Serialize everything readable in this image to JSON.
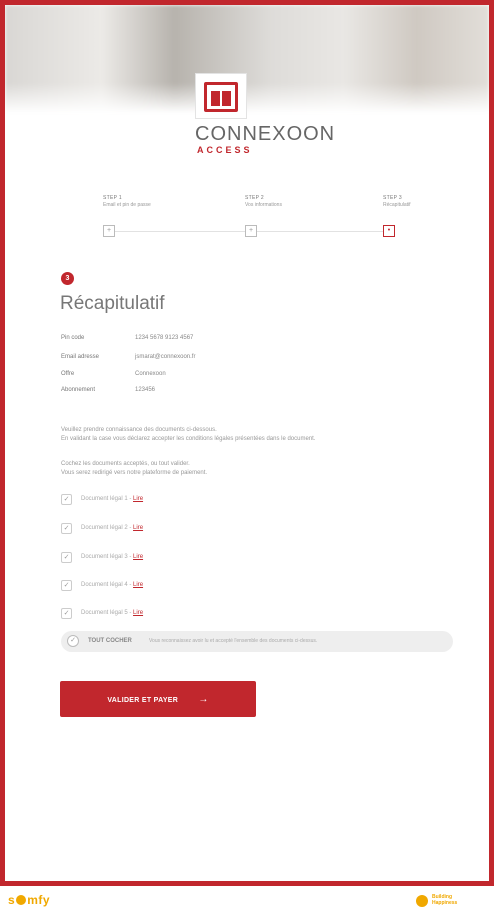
{
  "brand": {
    "name": "CONNEXOON",
    "sub": "ACCESS"
  },
  "steps": [
    {
      "title": "STEP 1",
      "subtitle": "Email et pin de passe",
      "marker": "+"
    },
    {
      "title": "STEP 2",
      "subtitle": "Vos informations",
      "marker": "+"
    },
    {
      "title": "STEP 3",
      "subtitle": "Récapitulatif",
      "marker": "•"
    }
  ],
  "page": {
    "badge": "3",
    "title": "Récapitulatif"
  },
  "details": [
    {
      "label": "Pin code",
      "value": "1234 5678 9123 4567"
    },
    {
      "label": "Email adresse",
      "value": "jsmarat@connexoon.fr"
    },
    {
      "label": "Offre",
      "value": "Connexoon"
    },
    {
      "label": "Abonnement",
      "value": "123456"
    }
  ],
  "paragraphs": [
    "Veuillez prendre connaissance des documents ci-dessous.",
    "En validant la case vous déclarez accepter les conditions légales présentées dans le document.",
    "Cochez les documents acceptés, ou tout valider.",
    "Vous serez redirigé vers notre plateforme de paiement."
  ],
  "documents": [
    {
      "label": "Document légal 1 -",
      "link": "Lire"
    },
    {
      "label": "Document légal 2 -",
      "link": "Lire"
    },
    {
      "label": "Document légal 3 -",
      "link": "Lire"
    },
    {
      "label": "Document légal 4 -",
      "link": "Lire"
    },
    {
      "label": "Document légal 5 -",
      "link": "Lire"
    }
  ],
  "accept_all": {
    "label": "TOUT COCHER",
    "note": "Vous reconnaissez avoir lu et accepté l'ensemble des documents ci-dessus."
  },
  "pay_button": {
    "label": "VALIDER ET PAYER",
    "arrow": "→"
  },
  "footer": {
    "somfy_s": "s",
    "somfy_rest": "mfy",
    "partner_line1": "Building",
    "partner_line2": "Happiness"
  },
  "colors": {
    "accent": "#c1272d",
    "somfy": "#f0a800"
  }
}
